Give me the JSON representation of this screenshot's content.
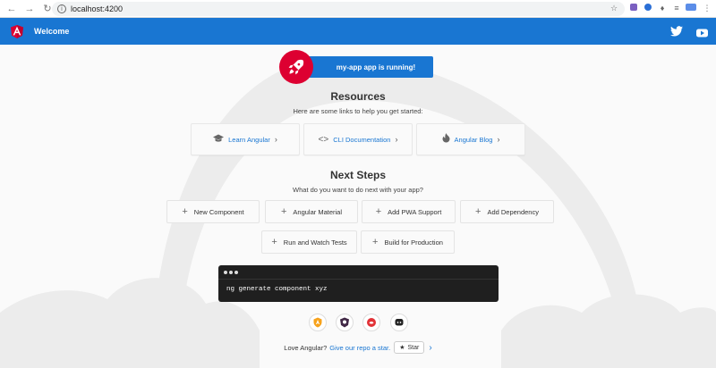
{
  "browser": {
    "url": "localhost:4200"
  },
  "toolbar": {
    "title": "Welcome"
  },
  "banner": {
    "text": "my-app app is running!"
  },
  "resources": {
    "title": "Resources",
    "subtitle": "Here are some links to help you get started:",
    "links": [
      {
        "label": "Learn Angular",
        "icon": "graduation-cap-icon"
      },
      {
        "label": "CLI Documentation",
        "icon": "code-icon"
      },
      {
        "label": "Angular Blog",
        "icon": "flame-icon"
      }
    ]
  },
  "next_steps": {
    "title": "Next Steps",
    "subtitle": "What do you want to do next with your app?",
    "items": [
      {
        "label": "New Component"
      },
      {
        "label": "Angular Material"
      },
      {
        "label": "Add PWA Support"
      },
      {
        "label": "Add Dependency"
      },
      {
        "label": "Run and Watch Tests"
      },
      {
        "label": "Build for Production"
      }
    ]
  },
  "terminal": {
    "command": "ng generate component xyz"
  },
  "footer": {
    "prefix": "Love Angular?",
    "link": "Give our repo a star.",
    "star_label": "Star"
  },
  "colors": {
    "primary": "#1976d2",
    "angular_red": "#dd0031"
  }
}
